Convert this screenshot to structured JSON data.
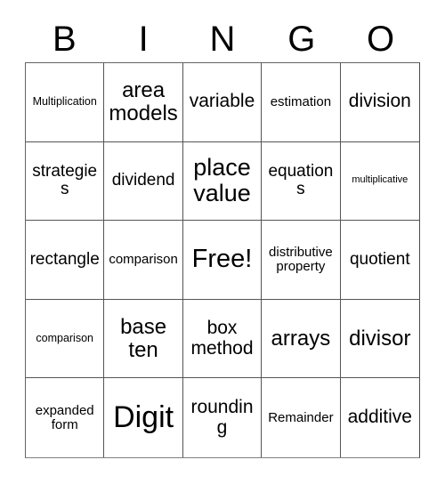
{
  "card": {
    "title": "BINGO",
    "header_letters": [
      "B",
      "I",
      "N",
      "G",
      "O"
    ],
    "free_space_label": "Free!",
    "free_space_index": 12,
    "grid_size": "5x5",
    "text_color": "#000000",
    "background_color": "#ffffff",
    "border_color": "#555555",
    "cells": [
      {
        "text": "Multiplication",
        "size": "fs-sm",
        "lines": 1
      },
      {
        "text": "area models",
        "size": "fs-2xl",
        "lines": 2
      },
      {
        "text": "variable",
        "size": "fs-xl",
        "lines": 1
      },
      {
        "text": "estimation",
        "size": "fs-md",
        "lines": 1
      },
      {
        "text": "division",
        "size": "fs-xl",
        "lines": 1
      },
      {
        "text": "strategies",
        "size": "fs-lg",
        "lines": 1
      },
      {
        "text": "dividend",
        "size": "fs-lg",
        "lines": 1
      },
      {
        "text": "place value",
        "size": "fs-3xl",
        "lines": 2
      },
      {
        "text": "equations",
        "size": "fs-lg",
        "lines": 1
      },
      {
        "text": "multiplicative",
        "size": "fs-xs",
        "lines": 1
      },
      {
        "text": "rectangle",
        "size": "fs-lg",
        "lines": 1
      },
      {
        "text": "comparison",
        "size": "fs-md",
        "lines": 1
      },
      {
        "text": "Free!",
        "size": "fs-4xl",
        "lines": 1
      },
      {
        "text": "distributive property",
        "size": "fs-md",
        "lines": 2
      },
      {
        "text": "quotient",
        "size": "fs-lg",
        "lines": 1
      },
      {
        "text": "comparison",
        "size": "fs-sm",
        "lines": 1
      },
      {
        "text": "base ten",
        "size": "fs-2xl",
        "lines": 2
      },
      {
        "text": "box method",
        "size": "fs-xl",
        "lines": 2
      },
      {
        "text": "arrays",
        "size": "fs-2xl",
        "lines": 1
      },
      {
        "text": "divisor",
        "size": "fs-2xl",
        "lines": 1
      },
      {
        "text": "expanded form",
        "size": "fs-md",
        "lines": 2
      },
      {
        "text": "Digit",
        "size": "fs-5xl",
        "lines": 1
      },
      {
        "text": "rounding",
        "size": "fs-xl",
        "lines": 1
      },
      {
        "text": "Remainder",
        "size": "fs-md",
        "lines": 1
      },
      {
        "text": "additive",
        "size": "fs-xl",
        "lines": 1
      }
    ]
  }
}
